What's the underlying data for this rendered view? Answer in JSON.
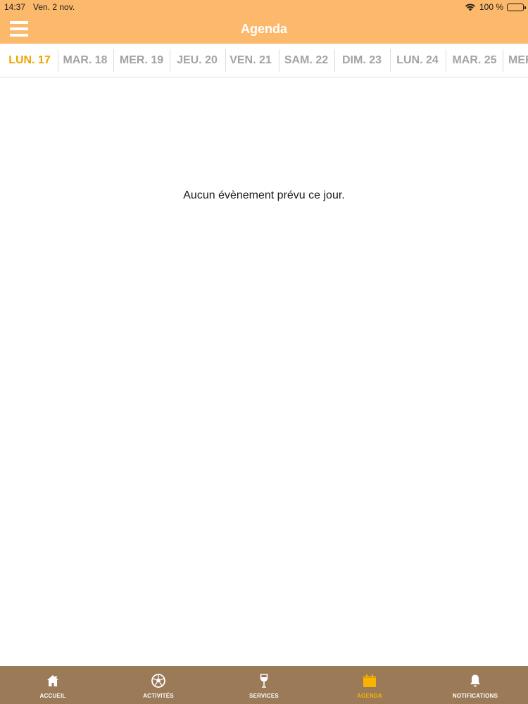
{
  "status_bar": {
    "time": "14:37",
    "date": "Ven. 2 nov.",
    "battery": "100 %"
  },
  "header": {
    "title": "Agenda",
    "background_color": "#fcb96b"
  },
  "day_tabs": [
    {
      "label": "LUN. 17",
      "active": true
    },
    {
      "label": "MAR. 18",
      "active": false
    },
    {
      "label": "MER. 19",
      "active": false
    },
    {
      "label": "JEU. 20",
      "active": false
    },
    {
      "label": "VEN. 21",
      "active": false
    },
    {
      "label": "SAM. 22",
      "active": false
    },
    {
      "label": "DIM. 23",
      "active": false
    },
    {
      "label": "LUN. 24",
      "active": false
    },
    {
      "label": "MAR. 25",
      "active": false
    },
    {
      "label": "MER",
      "active": false
    }
  ],
  "main": {
    "empty_message": "Aucun évènement prévu ce jour."
  },
  "tab_bar": {
    "background_color": "#9b7a57",
    "active_color": "#f7b300",
    "items": [
      {
        "label": "ACCUEIL",
        "icon": "home-icon",
        "active": false
      },
      {
        "label": "ACTIVITÉS",
        "icon": "soccer-ball-icon",
        "active": false
      },
      {
        "label": "SERVICES",
        "icon": "wine-glass-icon",
        "active": false
      },
      {
        "label": "AGENDA",
        "icon": "calendar-icon",
        "active": true
      },
      {
        "label": "NOTIFICATIONS",
        "icon": "bell-icon",
        "active": false
      }
    ]
  }
}
